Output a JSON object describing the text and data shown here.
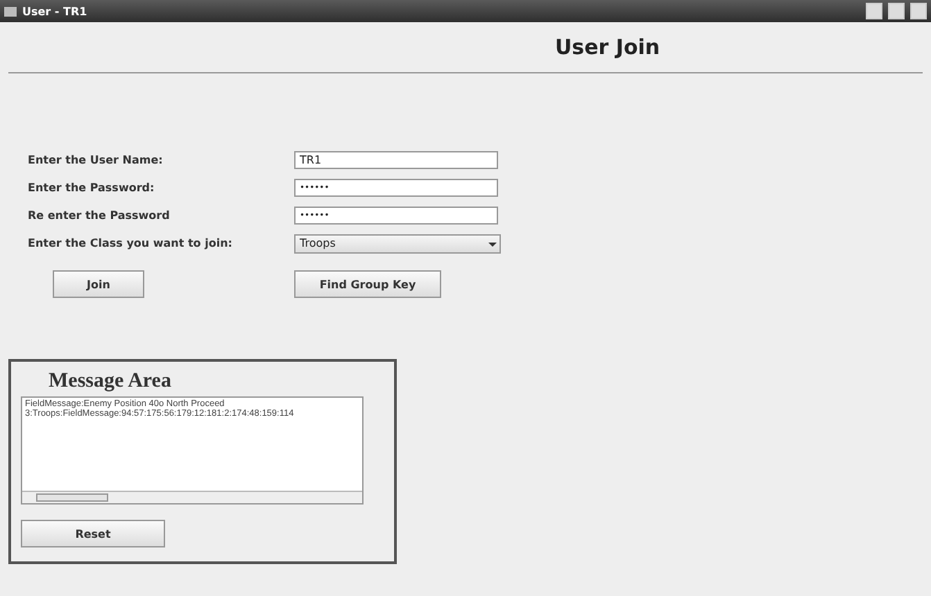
{
  "window": {
    "title": "User - TR1"
  },
  "heading": "User Join",
  "form": [
    {
      "kind": "text",
      "label": "Enter the User Name:",
      "value": "TR1"
    },
    {
      "kind": "password",
      "label": "Enter the Password:",
      "value": "••••••"
    },
    {
      "kind": "password",
      "label": "Re enter the Password",
      "value": "••••••"
    },
    {
      "kind": "select",
      "label": "Enter the Class you want to join:",
      "value": "Troops"
    }
  ],
  "buttons": [
    "Join",
    "Find Group Key"
  ],
  "message_area": {
    "title": "Message Area",
    "lines": [
      "FieldMessage:Enemy Position 40o North  Proceed",
      "3:Troops:FieldMessage:94:57:175:56:179:12:181:2:174:48:159:114"
    ],
    "button": "Reset"
  }
}
